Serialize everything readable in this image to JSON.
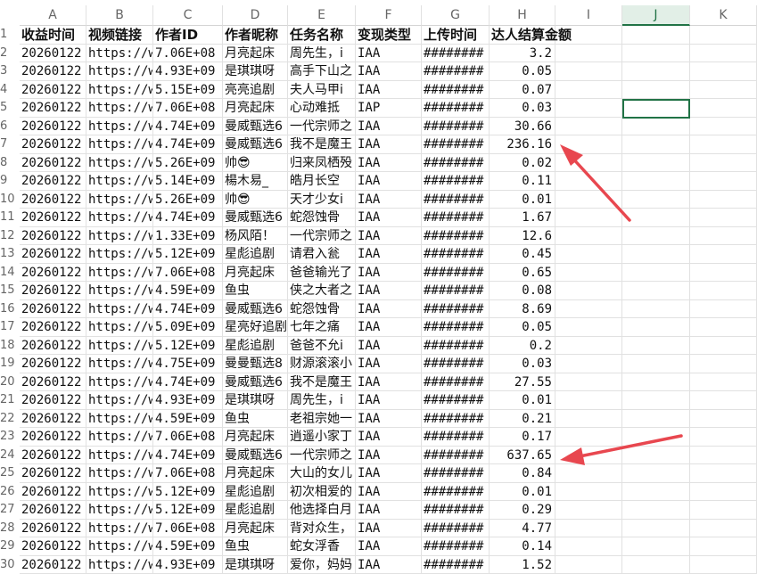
{
  "columns": [
    "A",
    "B",
    "C",
    "D",
    "E",
    "F",
    "G",
    "H",
    "I",
    "J",
    "K"
  ],
  "selected_column": "J",
  "selected_cell": "J5",
  "header_row": [
    "收益时间",
    "视频链接",
    "作者ID",
    "作者昵称",
    "任务名称",
    "变现类型",
    "上传时间",
    "达人结算金额"
  ],
  "rows": [
    {
      "n": "2",
      "cells": [
        "20260122",
        "https://w",
        "7.06E+08",
        "月亮起床",
        "周先生，i",
        "IAA",
        "########",
        "3.2"
      ]
    },
    {
      "n": "3",
      "cells": [
        "20260122",
        "https://w",
        "4.93E+09",
        "是琪琪呀",
        "高手下山之",
        "IAA",
        "########",
        "0.05"
      ]
    },
    {
      "n": "4",
      "cells": [
        "20260122",
        "https://w",
        "5.15E+09",
        "亮亮追剧",
        "夫人马甲ⅰ",
        "IAA",
        "########",
        "0.07"
      ]
    },
    {
      "n": "5",
      "cells": [
        "20260122",
        "https://w",
        "7.06E+08",
        "月亮起床",
        "心动难抵",
        "IAP",
        "########",
        "0.03"
      ]
    },
    {
      "n": "6",
      "cells": [
        "20260122",
        "https://w",
        "4.74E+09",
        "曼威甄选6",
        "一代宗师之",
        "IAA",
        "########",
        "30.66"
      ]
    },
    {
      "n": "7",
      "cells": [
        "20260122",
        "https://w",
        "4.74E+09",
        "曼威甄选6",
        "我不是魔王",
        "IAA",
        "########",
        "236.16"
      ]
    },
    {
      "n": "8",
      "cells": [
        "20260122",
        "https://w",
        "5.26E+09",
        "帅😎",
        "归来凤栖殁",
        "IAA",
        "########",
        "0.02"
      ]
    },
    {
      "n": "9",
      "cells": [
        "20260122",
        "https://w",
        "5.14E+09",
        "楊木易_",
        "皓月长空",
        "IAA",
        "########",
        "0.11"
      ]
    },
    {
      "n": "10",
      "cells": [
        "20260122",
        "https://w",
        "5.26E+09",
        "帅😎",
        "天才少女i",
        "IAA",
        "########",
        "0.01"
      ]
    },
    {
      "n": "11",
      "cells": [
        "20260122",
        "https://w",
        "4.74E+09",
        "曼威甄选6",
        "蛇怨蚀骨",
        "IAA",
        "########",
        "1.67"
      ]
    },
    {
      "n": "12",
      "cells": [
        "20260122",
        "https://w",
        "1.33E+09",
        "杨风陌！",
        "一代宗师之",
        "IAA",
        "########",
        "12.6"
      ]
    },
    {
      "n": "13",
      "cells": [
        "20260122",
        "https://w",
        "5.12E+09",
        "星彪追剧",
        "请君入瓮",
        "IAA",
        "########",
        "0.45"
      ]
    },
    {
      "n": "14",
      "cells": [
        "20260122",
        "https://w",
        "7.06E+08",
        "月亮起床",
        "爸爸输光了",
        "IAA",
        "########",
        "0.65"
      ]
    },
    {
      "n": "15",
      "cells": [
        "20260122",
        "https://w",
        "4.59E+09",
        "鱼虫",
        "侠之大者之",
        "IAA",
        "########",
        "0.08"
      ]
    },
    {
      "n": "16",
      "cells": [
        "20260122",
        "https://w",
        "4.74E+09",
        "曼威甄选6",
        "蛇怨蚀骨",
        "IAA",
        "########",
        "8.69"
      ]
    },
    {
      "n": "17",
      "cells": [
        "20260122",
        "https://w",
        "5.09E+09",
        "星亮好追剧",
        "七年之痛",
        "IAA",
        "########",
        "0.05"
      ]
    },
    {
      "n": "18",
      "cells": [
        "20260122",
        "https://w",
        "5.12E+09",
        "星彪追剧",
        "爸爸不允i",
        "IAA",
        "########",
        "0.2"
      ]
    },
    {
      "n": "19",
      "cells": [
        "20260122",
        "https://w",
        "4.75E+09",
        "曼曼甄选8",
        "财源滚滚小",
        "IAA",
        "########",
        "0.03"
      ]
    },
    {
      "n": "20",
      "cells": [
        "20260122",
        "https://w",
        "4.74E+09",
        "曼威甄选6",
        "我不是魔王",
        "IAA",
        "########",
        "27.55"
      ]
    },
    {
      "n": "21",
      "cells": [
        "20260122",
        "https://w",
        "4.93E+09",
        "是琪琪呀",
        "周先生，i",
        "IAA",
        "########",
        "0.01"
      ]
    },
    {
      "n": "22",
      "cells": [
        "20260122",
        "https://w",
        "4.59E+09",
        "鱼虫",
        "老祖宗她一",
        "IAA",
        "########",
        "0.21"
      ]
    },
    {
      "n": "23",
      "cells": [
        "20260122",
        "https://w",
        "7.06E+08",
        "月亮起床",
        "逍遥小家丁",
        "IAA",
        "########",
        "0.17"
      ]
    },
    {
      "n": "24",
      "cells": [
        "20260122",
        "https://w",
        "4.74E+09",
        "曼威甄选6",
        "一代宗师之",
        "IAA",
        "########",
        "637.65"
      ]
    },
    {
      "n": "25",
      "cells": [
        "20260122",
        "https://w",
        "7.06E+08",
        "月亮起床",
        "大山的女儿",
        "IAA",
        "########",
        "0.84"
      ]
    },
    {
      "n": "26",
      "cells": [
        "20260122",
        "https://w",
        "5.12E+09",
        "星彪追剧",
        "初次相爱的",
        "IAA",
        "########",
        "0.01"
      ]
    },
    {
      "n": "27",
      "cells": [
        "20260122",
        "https://w",
        "5.12E+09",
        "星彪追剧",
        "他选择白月",
        "IAA",
        "########",
        "0.29"
      ]
    },
    {
      "n": "28",
      "cells": [
        "20260122",
        "https://w",
        "7.06E+08",
        "月亮起床",
        "背对众生，",
        "IAA",
        "########",
        "4.77"
      ]
    },
    {
      "n": "29",
      "cells": [
        "20260122",
        "https://w",
        "4.59E+09",
        "鱼虫",
        "蛇女浮香",
        "IAA",
        "########",
        "0.14"
      ]
    },
    {
      "n": "30",
      "cells": [
        "20260122",
        "https://w",
        "4.93E+09",
        "是琪琪呀",
        "爱你，妈妈",
        "IAA",
        "########",
        "1.52"
      ]
    }
  ],
  "colors": {
    "accent": "#217346",
    "arrow": "#e8474f",
    "grid": "#e1e1e1"
  }
}
